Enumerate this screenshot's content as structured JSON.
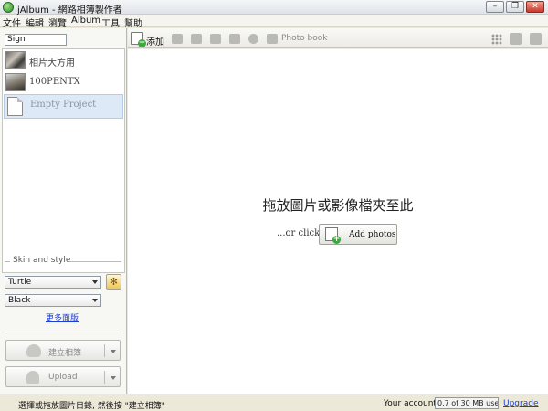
{
  "window": {
    "title": "jAlbum - 網路相簿製作者",
    "minimize_glyph": "–",
    "maximize_glyph": "❐",
    "close_glyph": "✕"
  },
  "menu": [
    "文件",
    "編輯",
    "瀏覽",
    "Album",
    "工具",
    "幫助"
  ],
  "sidebar": {
    "search_value": "Sign",
    "projects": [
      {
        "label": "相片大方用",
        "thumb": "photo"
      },
      {
        "label": "100PENTX",
        "thumb": "photo"
      },
      {
        "label": "Empty Project",
        "thumb": "document",
        "selected": true
      }
    ],
    "skin_section_title": "Skin and style",
    "skin_value": "Turtle",
    "style_value": "Black",
    "more_skins_link": "更多面版",
    "make_album_label": "建立相簿",
    "upload_label": "Upload"
  },
  "toolbar": {
    "add_label": "添加",
    "photobook_label": "Photo book"
  },
  "main": {
    "drop_title": "拖放圖片或影像檔夾至此",
    "or_click": "...or click",
    "add_photos_label": "Add photos"
  },
  "status": {
    "message": "選擇或拖放圖片目錄, 然後按 \"建立相簿\"",
    "account_label": "Your account:",
    "usage": "0.7 of 30 MB used",
    "upgrade_link": "Upgrade"
  },
  "colors": {
    "link": "#1a3fd8",
    "add_badge": "#3aa83a",
    "selection": "#dde9f6"
  }
}
